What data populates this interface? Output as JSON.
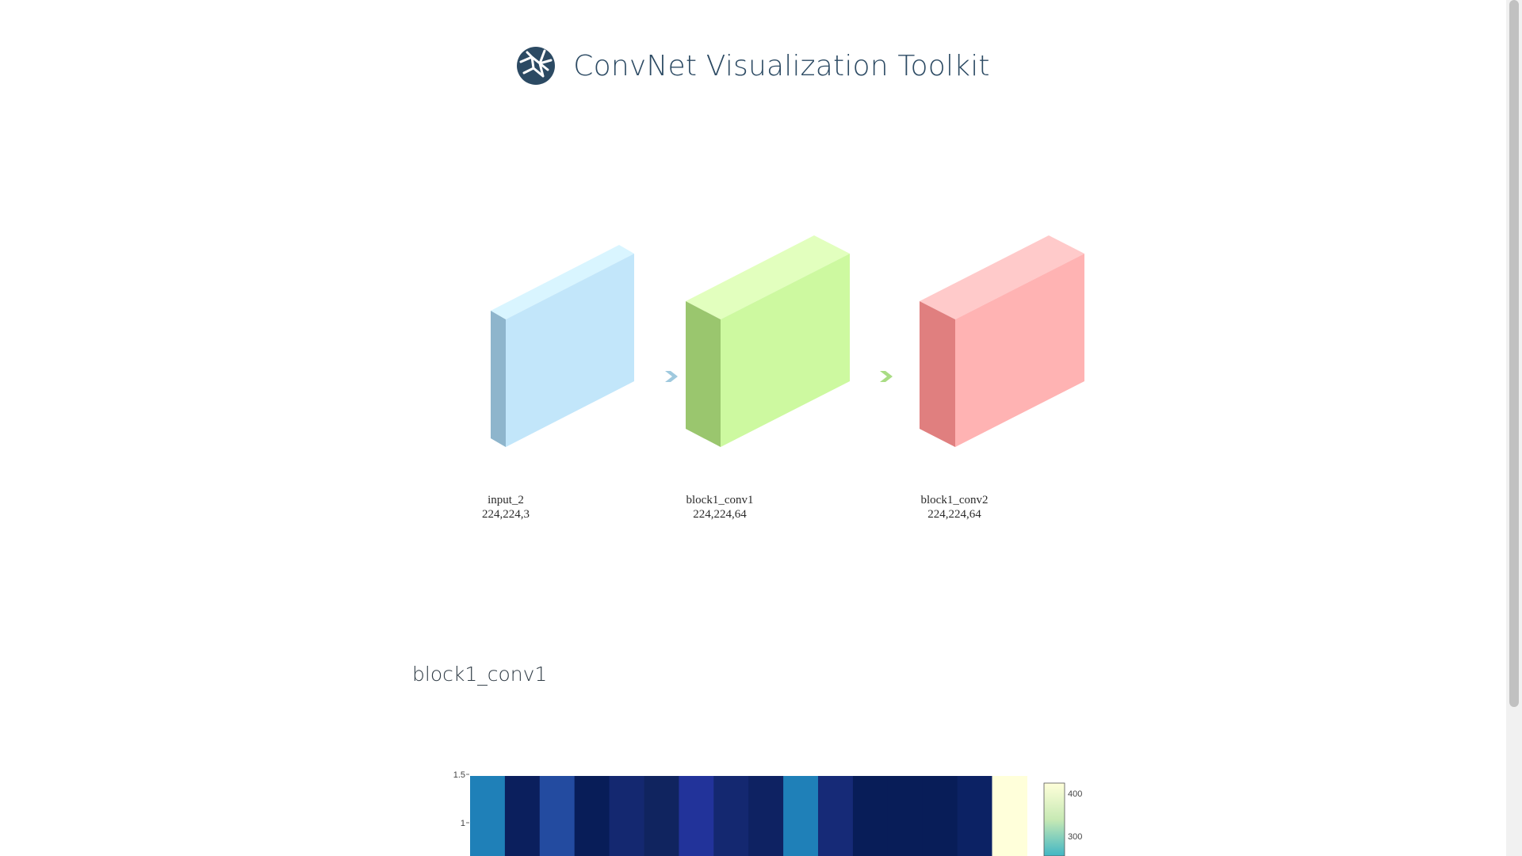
{
  "app": {
    "title": "ConvNet Visualization Toolkit",
    "logo_icon": "globe-network-icon",
    "accent_color": "#2c4a63"
  },
  "network": {
    "layers": [
      {
        "name": "input_2",
        "shape": "224,224,3",
        "front_color": "#c2e6fa",
        "side_color": "#8eb5cc",
        "top_color": "#d9f5ff"
      },
      {
        "name": "block1_conv1",
        "shape": "224,224,64",
        "front_color": "#cdf9a0",
        "side_color": "#9ac66e",
        "top_color": "#e2ffbe"
      },
      {
        "name": "block1_conv2",
        "shape": "224,224,64",
        "front_color": "#ffb3b3",
        "side_color": "#e07f7f",
        "top_color": "#ffcaca"
      }
    ],
    "connectors": [
      {
        "icon": "chevron-right-icon",
        "color": "#9fc9de"
      },
      {
        "icon": "chevron-right-icon",
        "color": "#a9dc84"
      }
    ]
  },
  "selected_layer": {
    "title": "block1_conv1"
  },
  "chart_data": {
    "type": "heatmap",
    "title": "",
    "y_ticks": [
      "1.5",
      "1"
    ],
    "colorbar_ticks": [
      "400",
      "300"
    ],
    "colorscale": "YlGnBu",
    "cell_colors": [
      "#1f80b8",
      "#0b1f5d",
      "#234ba0",
      "#081d58",
      "#142870",
      "#10245f",
      "#22339a",
      "#142870",
      "#0e2262",
      "#1f80b8",
      "#162a77",
      "#081d58",
      "#081d58",
      "#081d58",
      "#0c2264",
      "#ffffda"
    ]
  }
}
